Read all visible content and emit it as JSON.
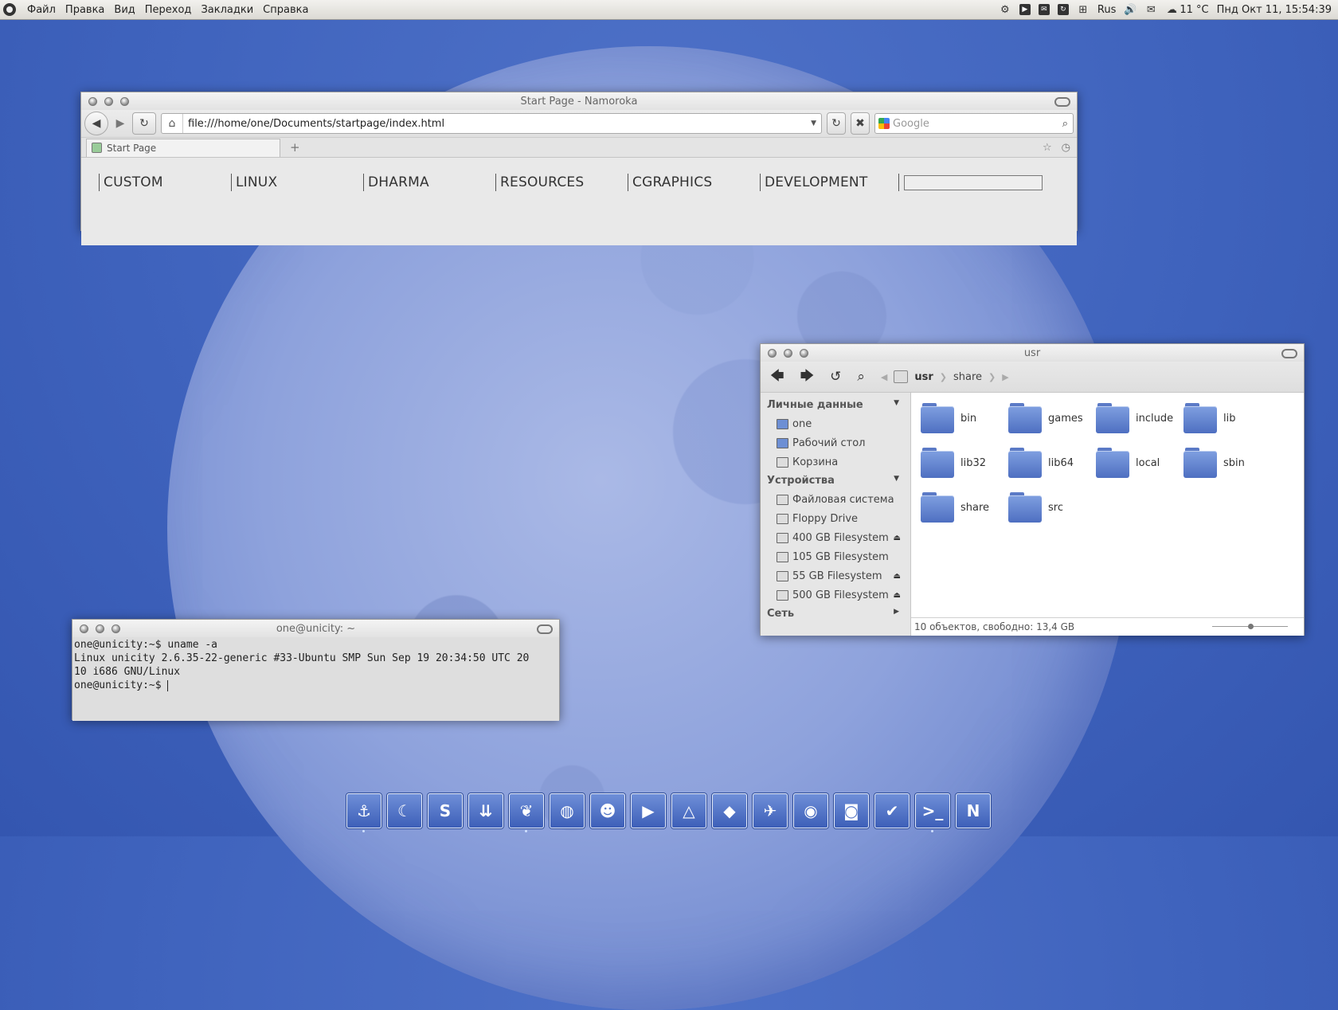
{
  "top_panel": {
    "menus": [
      "Файл",
      "Правка",
      "Вид",
      "Переход",
      "Закладки",
      "Справка"
    ],
    "keyboard_layout": "Rus",
    "weather": "11 °C",
    "clock": "Пнд Окт 11, 15:54:39"
  },
  "browser": {
    "title": "Start Page - Namoroka",
    "url": "file:///home/one/Documents/startpage/index.html",
    "search_placeholder": "Google",
    "tab_label": "Start Page",
    "tab_add": "+",
    "start_links": [
      "CUSTOM",
      "LINUX",
      "DHARMA",
      "RESOURCES",
      "CGRAPHICS",
      "DEVELOPMENT"
    ]
  },
  "file_manager": {
    "title": "usr",
    "breadcrumbs": [
      "usr",
      "share"
    ],
    "sidebar": {
      "personal_header": "Личные данные",
      "personal": [
        "one",
        "Рабочий стол",
        "Корзина"
      ],
      "devices_header": "Устройства",
      "devices": [
        {
          "label": "Файловая система",
          "eject": ""
        },
        {
          "label": "Floppy Drive",
          "eject": ""
        },
        {
          "label": "400 GB Filesystem",
          "eject": "⏏"
        },
        {
          "label": "105 GB Filesystem",
          "eject": ""
        },
        {
          "label": "55 GB Filesystem",
          "eject": "⏏"
        },
        {
          "label": "500 GB Filesystem",
          "eject": "⏏"
        }
      ],
      "network_header": "Сеть"
    },
    "folders": [
      "bin",
      "games",
      "include",
      "lib",
      "lib32",
      "lib64",
      "local",
      "sbin",
      "share",
      "src"
    ],
    "status": "10 объектов, свободно: 13,4 GB"
  },
  "terminal": {
    "title": "one@unicity: ~",
    "lines": [
      "one@unicity:~$ uname -a",
      "Linux unicity 2.6.35-22-generic #33-Ubuntu SMP Sun Sep 19 20:34:50 UTC 20",
      "10 i686 GNU/Linux",
      "one@unicity:~$ "
    ]
  },
  "dock": [
    {
      "name": "anchor-icon",
      "glyph": "⚓"
    },
    {
      "name": "firefox-icon",
      "glyph": "☾"
    },
    {
      "name": "skype-icon",
      "glyph": "S"
    },
    {
      "name": "download-icon",
      "glyph": "⇊"
    },
    {
      "name": "pidgin-icon",
      "glyph": "❦"
    },
    {
      "name": "globe-icon",
      "glyph": "◍"
    },
    {
      "name": "user-icon",
      "glyph": "☻"
    },
    {
      "name": "player-icon",
      "glyph": "▶"
    },
    {
      "name": "vlc-icon",
      "glyph": "△"
    },
    {
      "name": "inkscape-icon",
      "glyph": "◆"
    },
    {
      "name": "bird-icon",
      "glyph": "✈"
    },
    {
      "name": "eye-icon",
      "glyph": "◉"
    },
    {
      "name": "camera-icon",
      "glyph": "◙"
    },
    {
      "name": "tasks-icon",
      "glyph": "✔"
    },
    {
      "name": "terminal-icon",
      "glyph": ">_"
    },
    {
      "name": "notes-icon",
      "glyph": "N"
    }
  ]
}
